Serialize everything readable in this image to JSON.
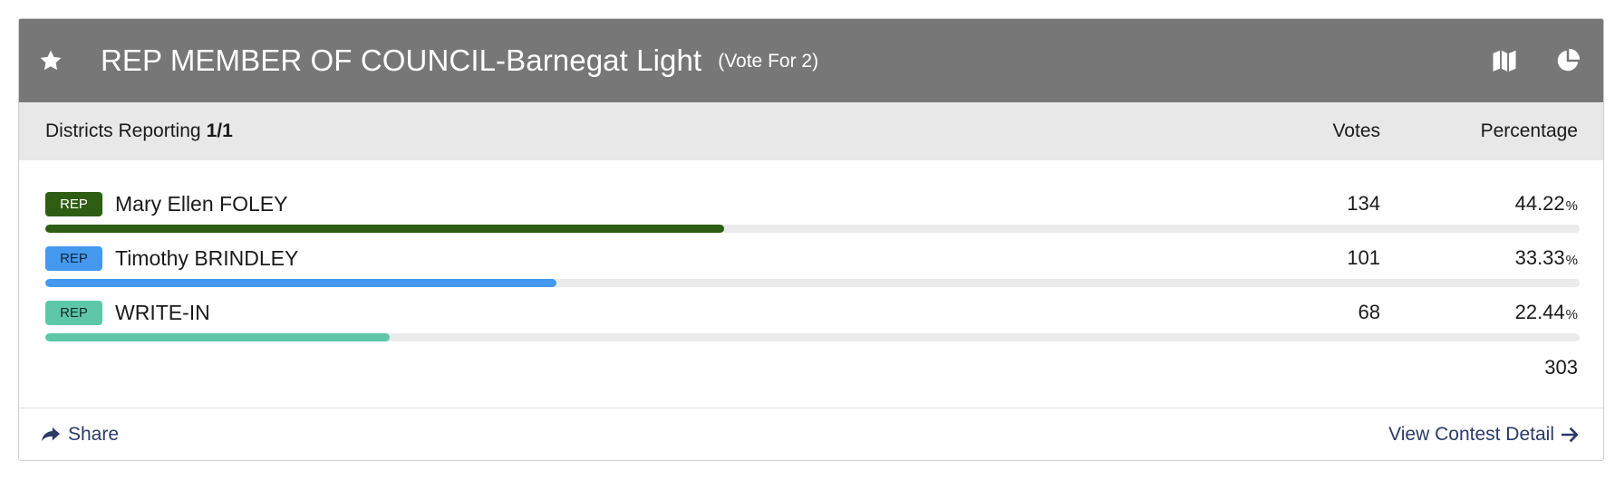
{
  "contest": {
    "title": "REP MEMBER OF COUNCIL-Barnegat Light",
    "vote_for": "(Vote For 2)"
  },
  "icons": {
    "favorite": "star-icon",
    "map": "map-icon",
    "chart": "pie-chart-icon",
    "share": "share-arrow-icon",
    "detail": "arrow-right-icon"
  },
  "subheader": {
    "districts_label": "Districts Reporting",
    "districts_value": "1/1",
    "votes_header": "Votes",
    "percentage_header": "Percentage"
  },
  "candidates": [
    {
      "party": "REP",
      "name": "Mary Ellen FOLEY",
      "votes": "134",
      "percentage": "44.22",
      "pct_symbol": "%",
      "bar_fraction": 0.4422,
      "color": "#2e5d14",
      "badge_text_color": "#ffffff"
    },
    {
      "party": "REP",
      "name": "Timothy BRINDLEY",
      "votes": "101",
      "percentage": "33.33",
      "pct_symbol": "%",
      "bar_fraction": 0.3333,
      "color": "#4499ee",
      "badge_text_color": "#10243a"
    },
    {
      "party": "REP",
      "name": "WRITE-IN",
      "votes": "68",
      "percentage": "22.44",
      "pct_symbol": "%",
      "bar_fraction": 0.2244,
      "color": "#5ec7a9",
      "badge_text_color": "#0f2d24"
    }
  ],
  "total_votes": "303",
  "footer": {
    "share_label": "Share",
    "detail_label": "View Contest Detail"
  },
  "colors": {
    "header_bg": "#777777",
    "subheader_bg": "#e8e8e8",
    "link": "#2b3a67"
  }
}
